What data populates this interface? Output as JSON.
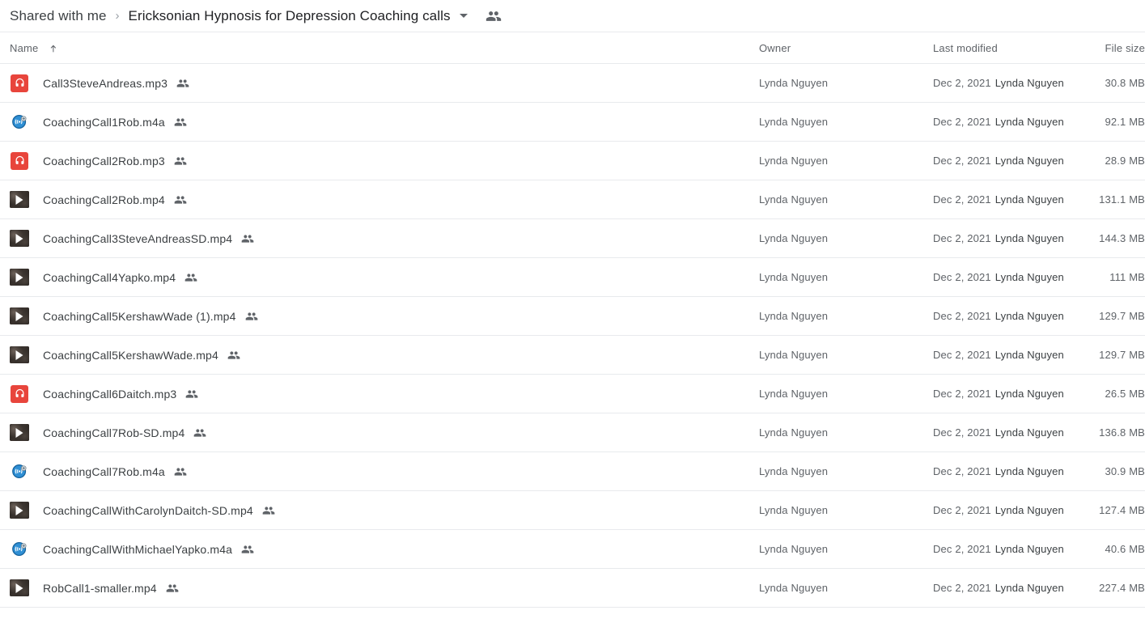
{
  "breadcrumb": {
    "root": "Shared with me",
    "separator": "›",
    "current": "Ericksonian Hypnosis for Depression Coaching calls"
  },
  "columns": {
    "name": "Name",
    "owner": "Owner",
    "last_modified": "Last modified",
    "file_size": "File size",
    "sort_direction": "ascending"
  },
  "files": [
    {
      "name": "Call3SteveAndreas.mp3",
      "icon": "mp3-audio-icon",
      "owner": "Lynda Nguyen",
      "modified_date": "Dec 2, 2021",
      "modified_by": "Lynda Nguyen",
      "size": "30.8 MB"
    },
    {
      "name": "CoachingCall1Rob.m4a",
      "icon": "m4a-audio-icon",
      "owner": "Lynda Nguyen",
      "modified_date": "Dec 2, 2021",
      "modified_by": "Lynda Nguyen",
      "size": "92.1 MB"
    },
    {
      "name": "CoachingCall2Rob.mp3",
      "icon": "mp3-audio-icon",
      "owner": "Lynda Nguyen",
      "modified_date": "Dec 2, 2021",
      "modified_by": "Lynda Nguyen",
      "size": "28.9 MB"
    },
    {
      "name": "CoachingCall2Rob.mp4",
      "icon": "mp4-video-icon",
      "owner": "Lynda Nguyen",
      "modified_date": "Dec 2, 2021",
      "modified_by": "Lynda Nguyen",
      "size": "131.1 MB"
    },
    {
      "name": "CoachingCall3SteveAndreasSD.mp4",
      "icon": "mp4-video-icon",
      "owner": "Lynda Nguyen",
      "modified_date": "Dec 2, 2021",
      "modified_by": "Lynda Nguyen",
      "size": "144.3 MB"
    },
    {
      "name": "CoachingCall4Yapko.mp4",
      "icon": "mp4-video-icon",
      "owner": "Lynda Nguyen",
      "modified_date": "Dec 2, 2021",
      "modified_by": "Lynda Nguyen",
      "size": "111 MB"
    },
    {
      "name": "CoachingCall5KershawWade (1).mp4",
      "icon": "mp4-video-icon",
      "owner": "Lynda Nguyen",
      "modified_date": "Dec 2, 2021",
      "modified_by": "Lynda Nguyen",
      "size": "129.7 MB"
    },
    {
      "name": "CoachingCall5KershawWade.mp4",
      "icon": "mp4-video-icon",
      "owner": "Lynda Nguyen",
      "modified_date": "Dec 2, 2021",
      "modified_by": "Lynda Nguyen",
      "size": "129.7 MB"
    },
    {
      "name": "CoachingCall6Daitch.mp3",
      "icon": "mp3-audio-icon",
      "owner": "Lynda Nguyen",
      "modified_date": "Dec 2, 2021",
      "modified_by": "Lynda Nguyen",
      "size": "26.5 MB"
    },
    {
      "name": "CoachingCall7Rob-SD.mp4",
      "icon": "mp4-video-icon",
      "owner": "Lynda Nguyen",
      "modified_date": "Dec 2, 2021",
      "modified_by": "Lynda Nguyen",
      "size": "136.8 MB"
    },
    {
      "name": "CoachingCall7Rob.m4a",
      "icon": "m4a-audio-icon",
      "owner": "Lynda Nguyen",
      "modified_date": "Dec 2, 2021",
      "modified_by": "Lynda Nguyen",
      "size": "30.9 MB"
    },
    {
      "name": "CoachingCallWithCarolynDaitch-SD.mp4",
      "icon": "mp4-video-icon",
      "owner": "Lynda Nguyen",
      "modified_date": "Dec 2, 2021",
      "modified_by": "Lynda Nguyen",
      "size": "127.4 MB"
    },
    {
      "name": "CoachingCallWithMichaelYapko.m4a",
      "icon": "m4a-audio-icon",
      "owner": "Lynda Nguyen",
      "modified_date": "Dec 2, 2021",
      "modified_by": "Lynda Nguyen",
      "size": "40.6 MB"
    },
    {
      "name": "RobCall1-smaller.mp4",
      "icon": "mp4-video-icon",
      "owner": "Lynda Nguyen",
      "modified_date": "Dec 2, 2021",
      "modified_by": "Lynda Nguyen",
      "size": "227.4 MB"
    }
  ],
  "icons": {
    "shared_badge": "shared-people-icon",
    "header_people": "people-icon",
    "dropdown": "chevron-down-icon",
    "sort": "arrow-up-icon"
  },
  "colors": {
    "mp3_red": "#e8453c",
    "m4a_blue": "#1a73c8",
    "text_primary": "#202124",
    "text_secondary": "#5f6368",
    "divider": "#e8eaed"
  }
}
